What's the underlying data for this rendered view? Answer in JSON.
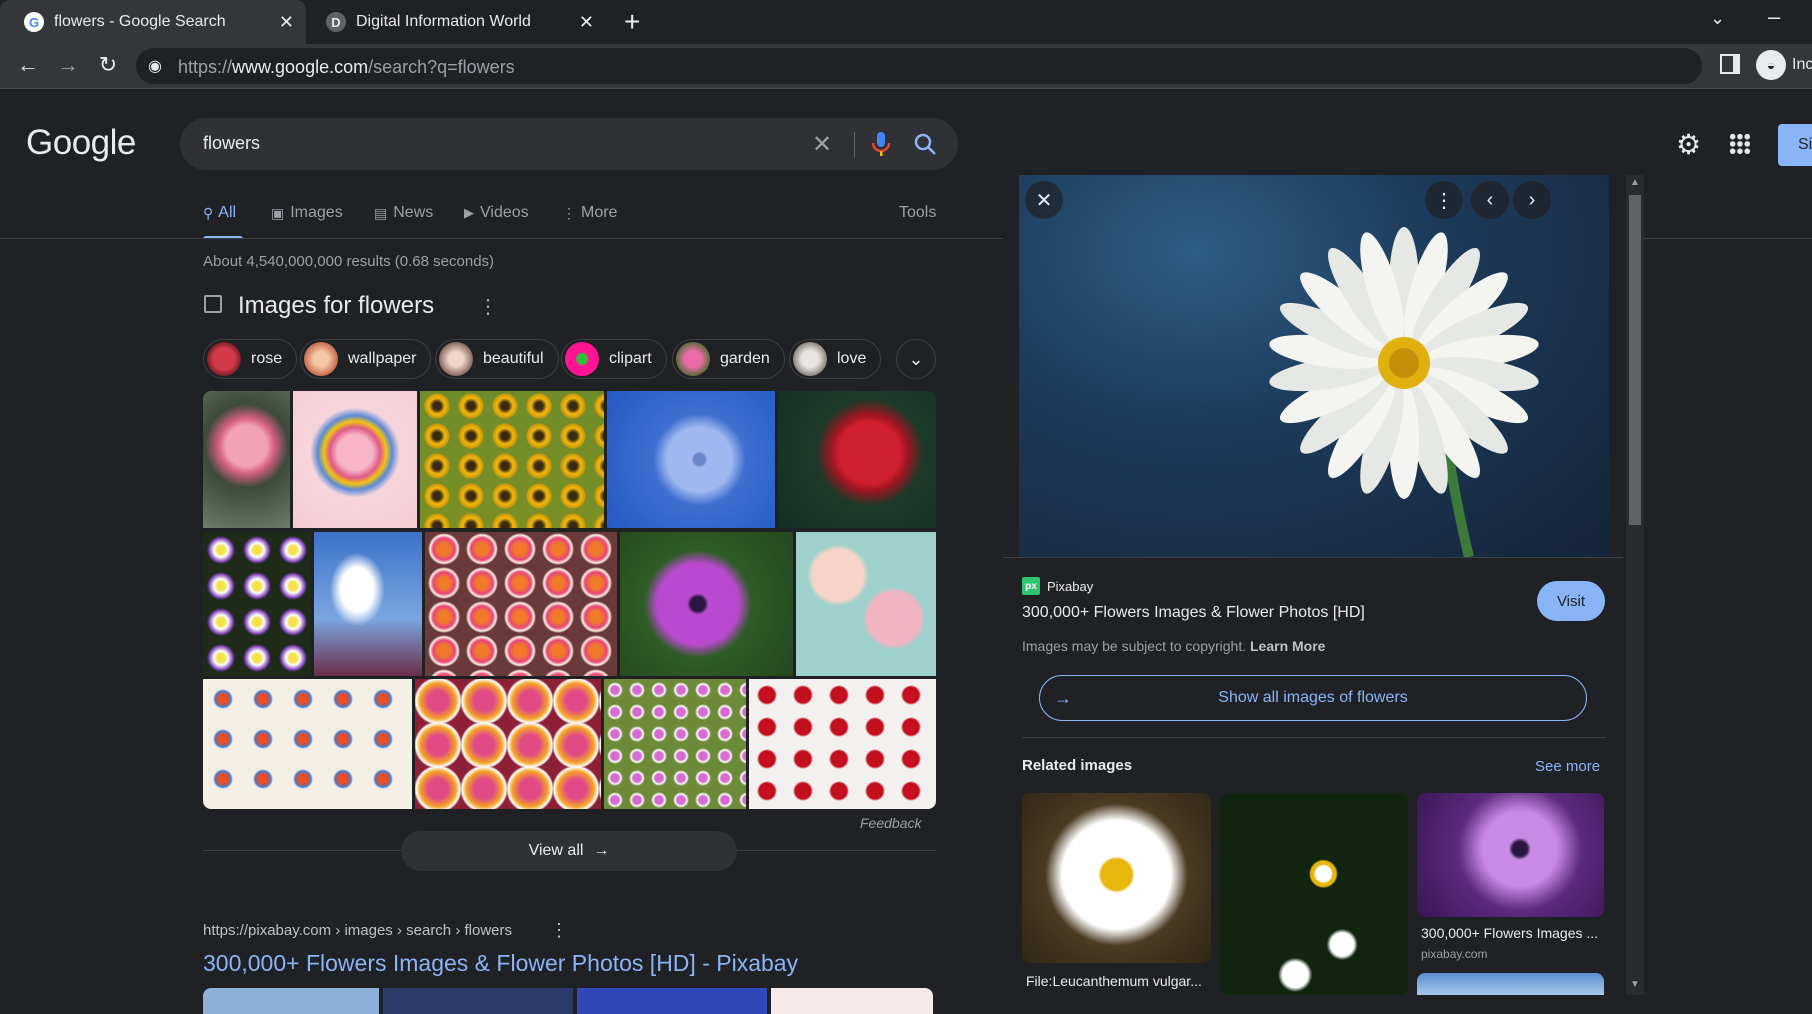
{
  "browser": {
    "tabs": [
      {
        "title": "flowers - Google Search",
        "active": true
      },
      {
        "title": "Digital Information World",
        "active": false
      }
    ],
    "url_prefix": "https://",
    "url_host": "www.google.com",
    "url_path": "/search?q=flowers",
    "incognito_label": "Inc"
  },
  "header": {
    "logo": "Google",
    "query": "flowers",
    "signin_label": "Si"
  },
  "nav": {
    "tabs": [
      "All",
      "Images",
      "News",
      "Videos",
      "More"
    ],
    "tools": "Tools"
  },
  "results": {
    "stats": "About 4,540,000,000 results (0.68 seconds)",
    "images_title": "Images for flowers",
    "chips": [
      "rose",
      "wallpaper",
      "beautiful",
      "clipart",
      "garden",
      "love"
    ],
    "feedback": "Feedback",
    "view_all": "View all",
    "result_breadcrumb": "https://pixabay.com › images › search › flowers",
    "result_title": "300,000+ Flowers Images & Flower Photos [HD] - Pixabay"
  },
  "panel": {
    "source": "Pixabay",
    "title": "300,000+ Flowers Images & Flower Photos [HD]",
    "copyright": "Images may be subject to copyright.",
    "learn_more": "Learn More",
    "visit": "Visit",
    "show_all": "Show all images of flowers",
    "related_title": "Related images",
    "see_more": "See more",
    "related": [
      {
        "caption": "File:Leucanthemum vulgar..."
      },
      {
        "caption": ""
      },
      {
        "caption": "300,000+ Flowers Images ...",
        "source": "pixabay.com"
      }
    ]
  },
  "colors": {
    "background": "#202124",
    "accent": "#8ab4f8",
    "surface": "#303134"
  }
}
